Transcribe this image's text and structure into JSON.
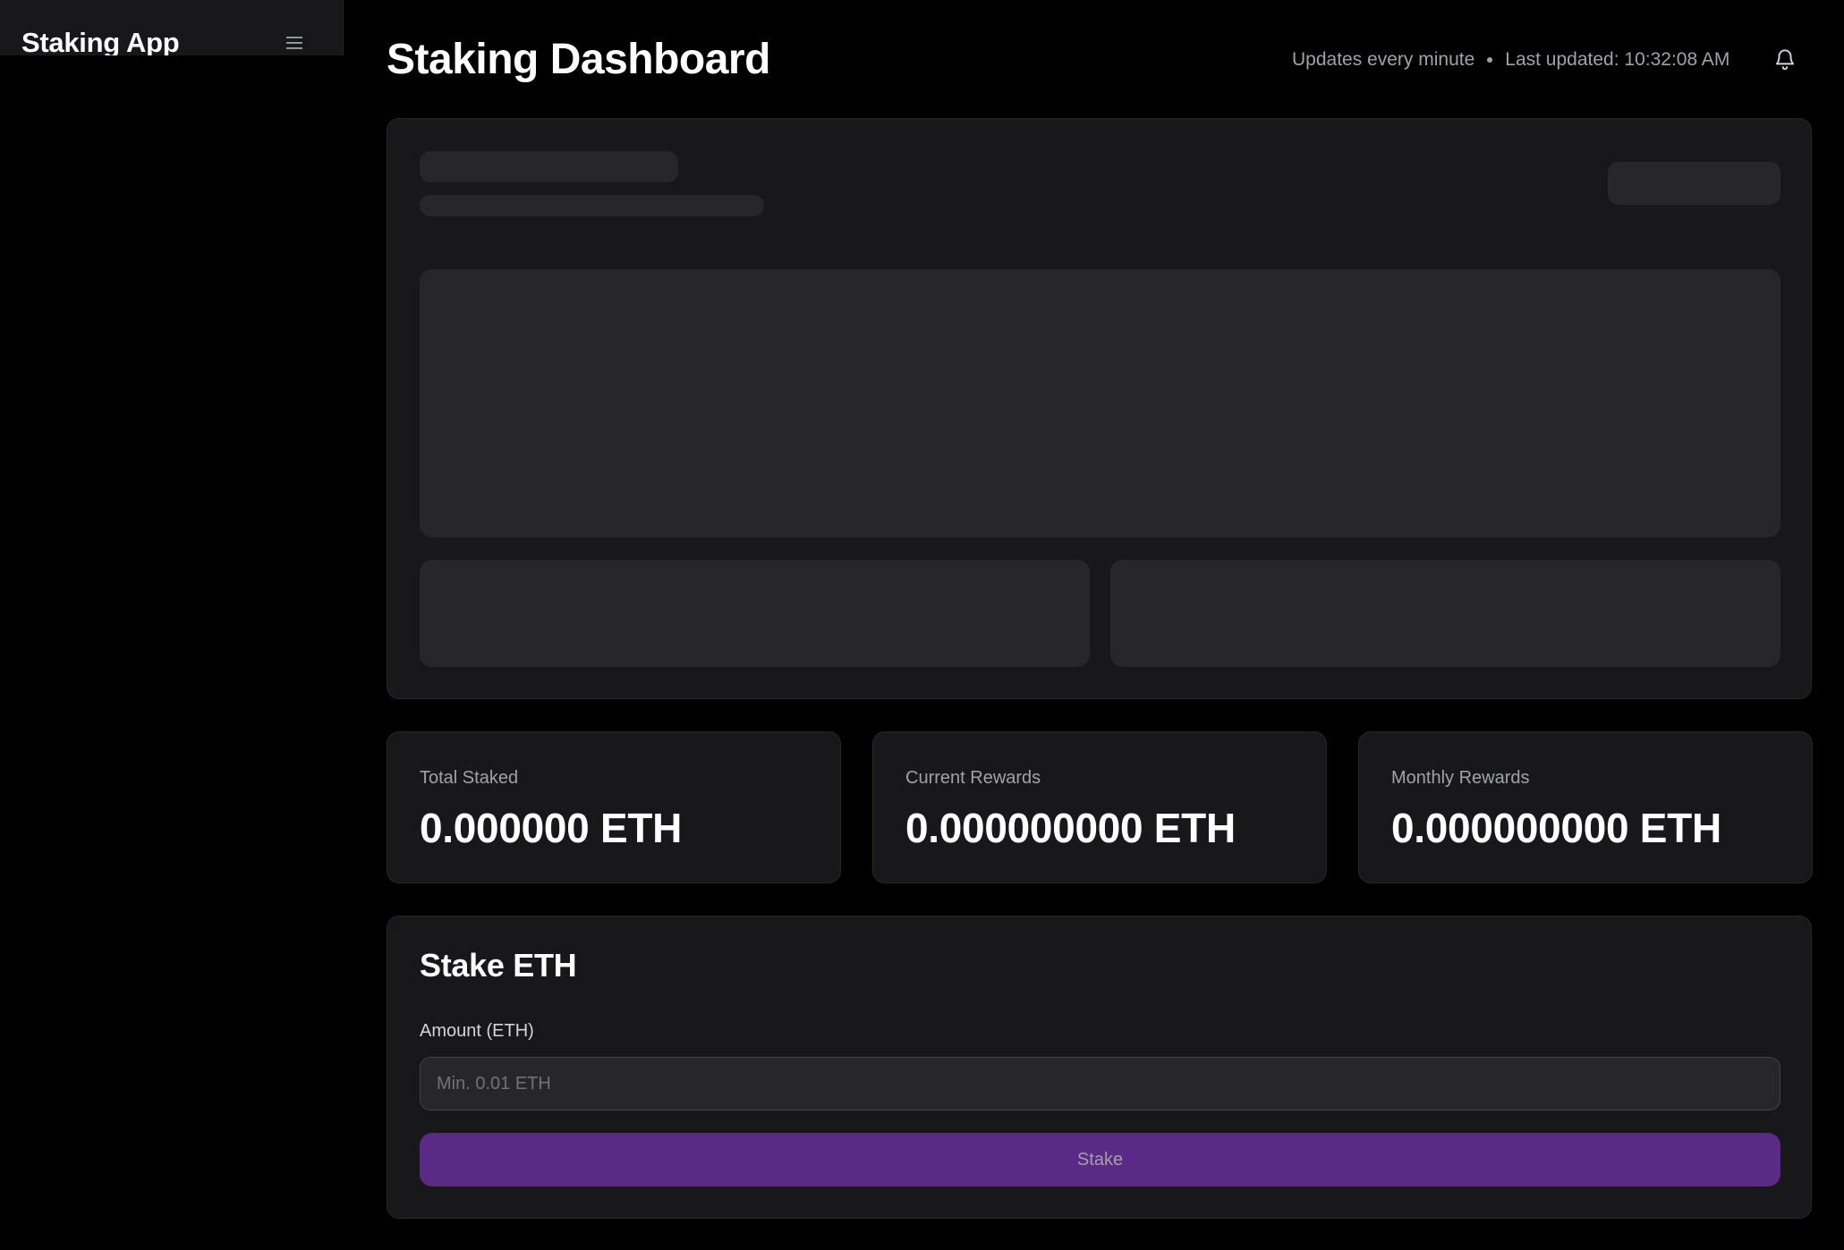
{
  "sidebar": {
    "brand": "Staking App",
    "menu_icon": "menu-icon"
  },
  "header": {
    "title": "Staking Dashboard",
    "update_frequency": "Updates every minute",
    "last_updated": "Last updated: 10:32:08 AM",
    "notification_icon": "bell-icon"
  },
  "stats": [
    {
      "label": "Total Staked",
      "value": "0.000000 ETH"
    },
    {
      "label": "Current Rewards",
      "value": "0.000000000 ETH"
    },
    {
      "label": "Monthly Rewards",
      "value": "0.000000000 ETH"
    }
  ],
  "stake_form": {
    "title": "Stake ETH",
    "amount_label": "Amount (ETH)",
    "amount_value": "",
    "amount_placeholder": "Min. 0.01 ETH",
    "button_label": "Stake"
  },
  "colors": {
    "background": "#000000",
    "panel": "#18181b",
    "skeleton": "#27272a",
    "accent": "#5b2a86",
    "muted_text": "#a1a1aa"
  }
}
